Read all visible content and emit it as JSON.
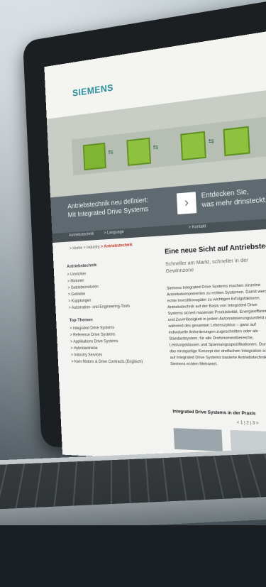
{
  "brand": {
    "logo": "SIEMENS"
  },
  "banner": {
    "left_line1": "Antriebstechnik neu definiert:",
    "left_line2": "Mit Integrated Drive Systems",
    "right_line1": "Entdecken Sie,",
    "right_line2": "was mehr drinsteckt."
  },
  "nav": {
    "item1": "Antriebstechnik",
    "item2": "> Language",
    "item3": "> Kontakt"
  },
  "breadcrumb": {
    "a": "> Home",
    "b": "> Industry",
    "c": "> Antriebstechnik"
  },
  "sidebar": {
    "heading": "Antriebstechnik",
    "items": [
      "> Umrichter",
      "> Motoren",
      "> Getriebemotoren",
      "> Getriebe",
      "> Kupplungen",
      "> Automation- und Engineering-Tools"
    ],
    "topics_heading": "Top-Themen",
    "topics": [
      "> Integrated Drive Systems",
      "> Reference Drive Systems",
      "> Applikations Drive Systems",
      "> Hybridantriebe",
      "> Industry Services",
      "> Kein Motors & Drive Contracts (Englisch)"
    ]
  },
  "main": {
    "title": "Eine neue Sicht auf Antriebstechnik",
    "subtitle": "Schneller am Markt, schneller in der Gewinnzone",
    "body": "Siemens Integrated Drive Systems machen einzelne Antriebskomponenten zu echten Systemen. Damit werden echte Investitionsgüter zu wichtigen Erfolgsfaktoren. Antriebstechnik auf der Basis von Integrated Drive Systems sichert maximale Produktivität, Energieeffizienz und Zuverlässigkeit in jedem Automatisierungsumfeld und während des gesamten Lebenszyklus – ganz auf individuelle Anforderungen zugeschnitten oder als Standardsystem, für alle Drehmomentbereiche, Leistungsklassen und Spannungsspezifikationen. Durch das einzigartige Konzept der dreifachen Integration schafft auf Integrated Drive Systems basierte Antriebstechnik von Siemens echten Mehrwert.",
    "section": "Integrated Drive Systems in der Praxis",
    "pager": "< 1 | 2 | 3 >"
  }
}
